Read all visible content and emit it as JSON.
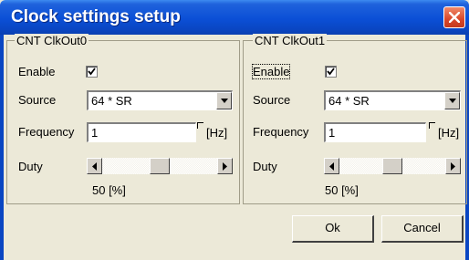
{
  "window": {
    "title": "Clock settings setup"
  },
  "groups": [
    {
      "title": "CNT ClkOut0",
      "enable_label": "Enable",
      "enable_checked": true,
      "source_label": "Source",
      "source_value": "64 * SR",
      "frequency_label": "Frequency",
      "frequency_value": "1",
      "frequency_unit": "[Hz]",
      "duty_label": "Duty",
      "duty_value": "50 [%]",
      "duty_percent": 50
    },
    {
      "title": "CNT ClkOut1",
      "enable_label": "Enable",
      "enable_checked": true,
      "source_label": "Source",
      "source_value": "64 * SR",
      "frequency_label": "Frequency",
      "frequency_value": "1",
      "frequency_unit": "[Hz]",
      "duty_label": "Duty",
      "duty_value": "50 [%]",
      "duty_percent": 50
    }
  ],
  "buttons": {
    "ok_label": "Ok",
    "cancel_label": "Cancel"
  },
  "icons": {
    "close": "close-icon",
    "checkbox": "checkmark-icon",
    "dropdown": "chevron-down-icon",
    "scroll_left": "arrow-left-icon",
    "scroll_right": "arrow-right-icon"
  },
  "colors": {
    "titlebar": "#0b4fd6",
    "dialog_bg": "#ece9d8",
    "close_button": "#d9472a"
  }
}
